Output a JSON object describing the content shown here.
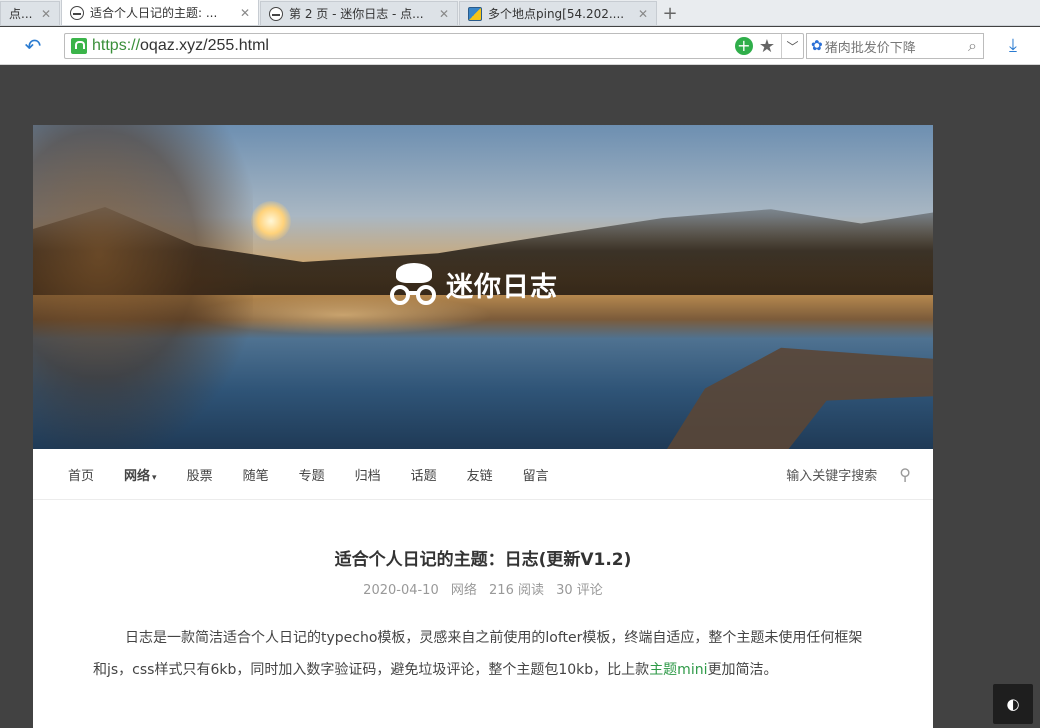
{
  "browser": {
    "tabs": [
      {
        "title": "点...",
        "active": false
      },
      {
        "title": "适合个人日记的主题: ...",
        "active": true
      },
      {
        "title": "第 2 页 - 迷你日志 - 点...",
        "active": false
      },
      {
        "title": "多个地点ping[54.202....",
        "active": false
      }
    ],
    "new_tab_label": "+",
    "close_label": "✕",
    "url": {
      "scheme": "https://",
      "rest": "oqaz.xyz/255.html"
    },
    "search_placeholder": "猪肉批发价下降",
    "icons": {
      "back": "back-arrow-icon",
      "lock": "lock-icon",
      "plus": "plus-circle-icon",
      "star": "star-icon",
      "dropdown": "chevron-down-icon",
      "engine": "paw-icon",
      "search": "search-icon",
      "download": "download-icon"
    }
  },
  "site": {
    "logo_text": "迷你日志",
    "nav": [
      {
        "label": "首页",
        "bold": false
      },
      {
        "label": "网络",
        "bold": true,
        "caret": "▾"
      },
      {
        "label": "股票",
        "bold": false
      },
      {
        "label": "随笔",
        "bold": false
      },
      {
        "label": "专题",
        "bold": false
      },
      {
        "label": "归档",
        "bold": false
      },
      {
        "label": "话题",
        "bold": false
      },
      {
        "label": "友链",
        "bold": false
      },
      {
        "label": "留言",
        "bold": false
      }
    ],
    "search_placeholder": "输入关键字搜索"
  },
  "post": {
    "title": "适合个人日记的主题：日志(更新V1.2)",
    "date": "2020-04-10",
    "category": "网络",
    "reads": "216 阅读",
    "comments": "30 评论",
    "body_before": "日志是一款简洁适合个人日记的typecho模板，灵感来自之前使用的lofter模板，终端自适应，整个主题未使用任何框架和js，css样式只有6kb，同时加入数字验证码，避免垃圾评论，整个主题包10kb，比上款",
    "body_link": "主题mini",
    "body_after": "更加简洁。"
  },
  "theme_toggle_icon": "◐",
  "colors": {
    "link_green": "#2f9a48",
    "page_bg": "#424242",
    "https_green": "#3a8f3a"
  }
}
